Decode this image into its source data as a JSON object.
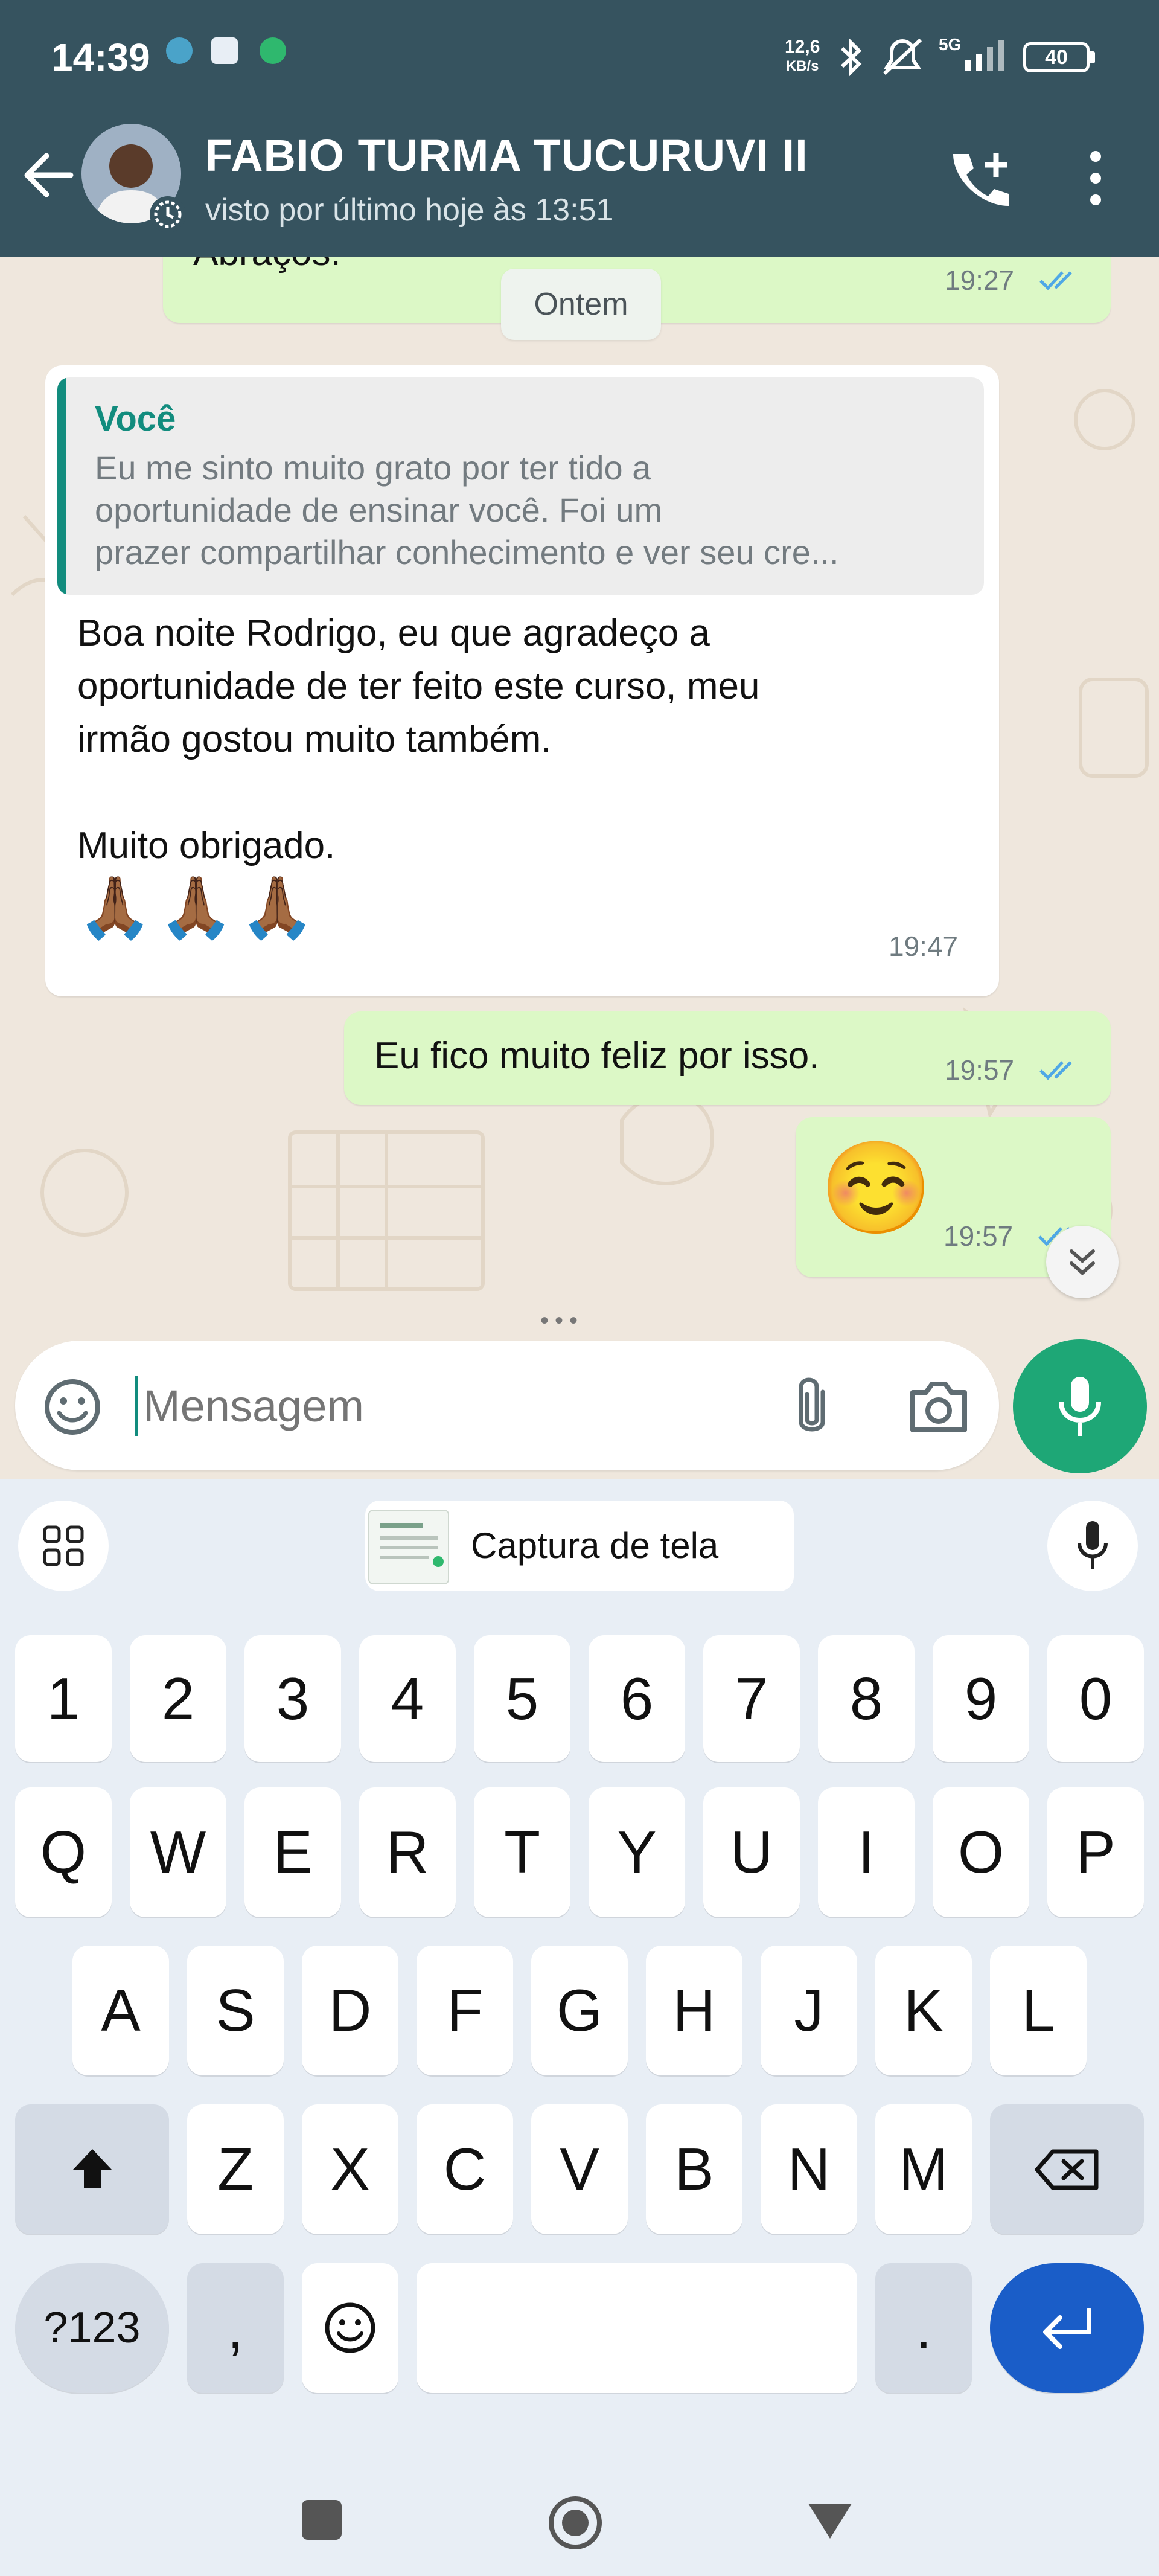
{
  "status_bar": {
    "time": "14:39",
    "net_speed_value": "12,6",
    "net_speed_unit": "KB/s",
    "network": "5G",
    "battery": "40"
  },
  "header": {
    "contact_name": "FABIO TURMA TUCURUVI II",
    "last_seen": "visto por último hoje às 13:51"
  },
  "chat": {
    "date_chip": "Ontem",
    "messages": [
      {
        "direction": "out",
        "text": "Abraços.",
        "time": "19:27"
      },
      {
        "direction": "in",
        "quote_author": "Você",
        "quote_text": "Eu me sinto muito grato por ter tido a\noportunidade de ensinar você. Foi um\nprazer compartilhar conhecimento e ver seu cre...",
        "text": "Boa noite Rodrigo, eu que agradeço a\noportunidade de ter feito este curso, meu\nirmão gostou muito também.\n\nMuito obrigado.",
        "emoji": "🙏🏾🙏🏾🙏🏾",
        "time": "19:47"
      },
      {
        "direction": "out",
        "text": "Eu fico muito feliz por isso.",
        "time": "19:57"
      },
      {
        "direction": "out",
        "emoji": "☺️",
        "time": "19:57"
      }
    ]
  },
  "input": {
    "placeholder": "Mensagem"
  },
  "keyboard": {
    "clipboard_chip": "Captura de tela",
    "row_numbers": [
      "1",
      "2",
      "3",
      "4",
      "5",
      "6",
      "7",
      "8",
      "9",
      "0"
    ],
    "row_q": [
      "Q",
      "W",
      "E",
      "R",
      "T",
      "Y",
      "U",
      "I",
      "O",
      "P"
    ],
    "row_a": [
      "A",
      "S",
      "D",
      "F",
      "G",
      "H",
      "J",
      "K",
      "L"
    ],
    "row_z": [
      "Z",
      "X",
      "C",
      "V",
      "B",
      "N",
      "M"
    ],
    "symbols_key": "?123",
    "comma_key": ",",
    "period_key": "."
  },
  "colors": {
    "header_bg": "#36535f",
    "chat_bg": "#efe7dd",
    "outgoing_bubble": "#dcf8c6",
    "incoming_bubble": "#ffffff",
    "accent_green": "#1ea776",
    "enter_key": "#1a5dc8"
  }
}
